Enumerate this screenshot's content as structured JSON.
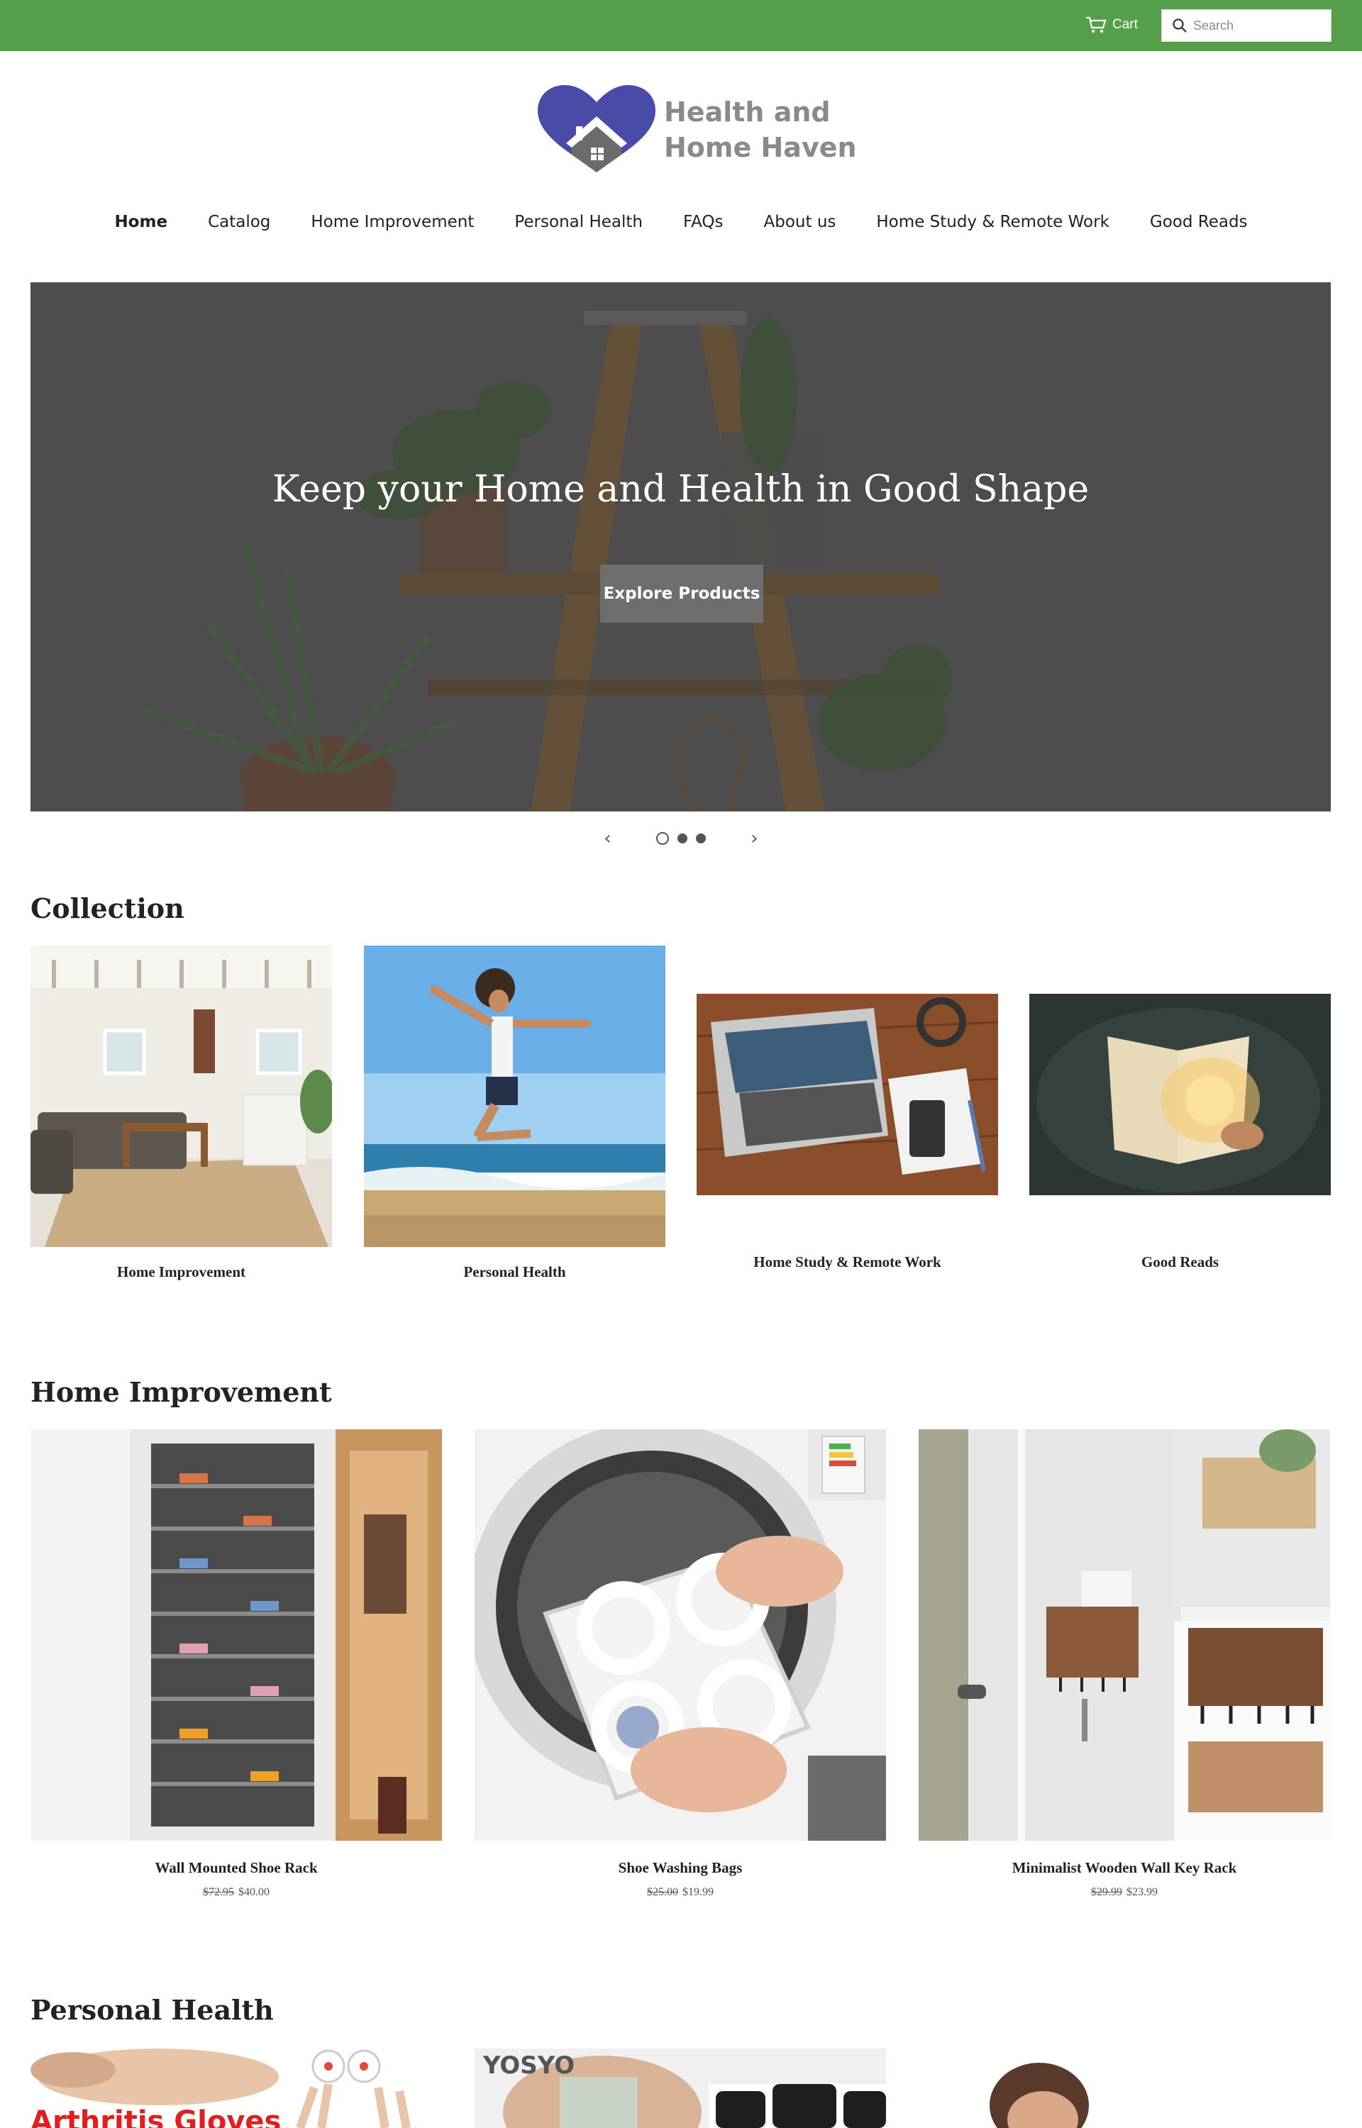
{
  "header": {
    "cart_label": "Cart",
    "search_placeholder": "Search",
    "logo_line1": "Health and",
    "logo_line2": "Home Haven"
  },
  "nav": {
    "items": [
      {
        "label": "Home",
        "active": true
      },
      {
        "label": "Catalog"
      },
      {
        "label": "Home Improvement"
      },
      {
        "label": "Personal Health"
      },
      {
        "label": "FAQs"
      },
      {
        "label": "About us"
      },
      {
        "label": "Home Study & Remote Work"
      },
      {
        "label": "Good Reads"
      }
    ]
  },
  "hero": {
    "title": "Keep your Home and Health in Good Shape",
    "button_label": "Explore Products",
    "prev_glyph": "‹",
    "next_glyph": "›",
    "slide_count": 3,
    "current_slide": 1
  },
  "collection": {
    "title": "Collection",
    "items": [
      {
        "label": "Home Improvement"
      },
      {
        "label": "Personal Health"
      },
      {
        "label": "Home Study & Remote Work"
      },
      {
        "label": "Good Reads"
      }
    ]
  },
  "home_improvement": {
    "title": "Home Improvement",
    "products": [
      {
        "name": "Wall Mounted Shoe Rack",
        "old_price": "$72.95",
        "price": "$40.00"
      },
      {
        "name": "Shoe Washing Bags",
        "old_price": "$25.00",
        "price": "$19.99"
      },
      {
        "name": "Minimalist Wooden Wall Key Rack",
        "old_price": "$29.99",
        "price": "$23.99"
      }
    ]
  },
  "personal_health": {
    "title": "Personal Health",
    "image_text_1": "Arthritis Gloves",
    "image_text_2": "YOSYO"
  },
  "colors": {
    "topbar": "#54a04a",
    "logo_heart": "#4a4aa8",
    "logo_text": "#8a8a8a",
    "hero_overlay": "#565656",
    "button": "#6e6e6e"
  },
  "icons": [
    "cart-icon",
    "search-icon",
    "chevron-left-icon",
    "chevron-right-icon",
    "house-icon"
  ]
}
